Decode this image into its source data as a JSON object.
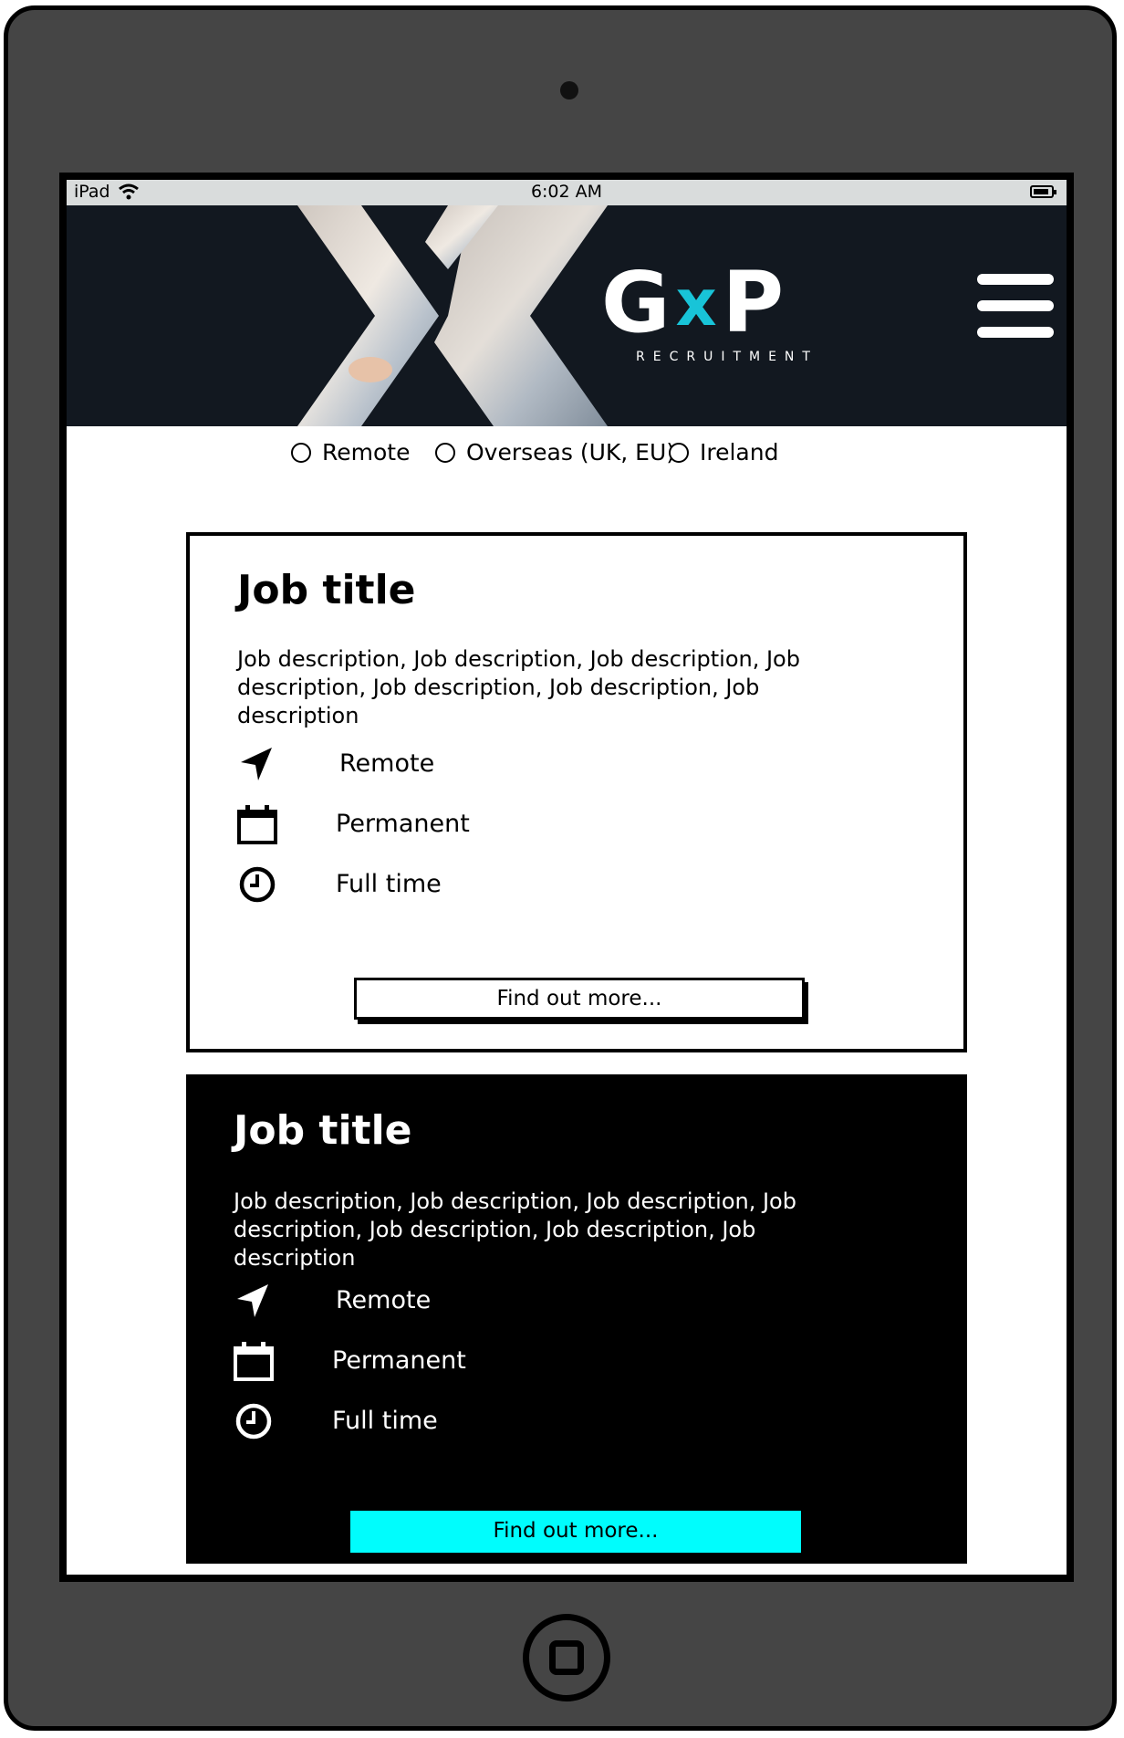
{
  "status_bar": {
    "device": "iPad",
    "time": "6:02 AM"
  },
  "header": {
    "logo_text_left": "G",
    "logo_text_mid": "x",
    "logo_text_right": "P",
    "logo_sub": "RECRUITMENT",
    "menu_icon": "hamburger-icon"
  },
  "filters": [
    {
      "label": "Remote",
      "selected": false
    },
    {
      "label": "Overseas (UK, EU)",
      "selected": false
    },
    {
      "label": "Ireland",
      "selected": false
    }
  ],
  "jobs": [
    {
      "title": "Job title",
      "description": "Job description, Job description, Job description, Job description, Job description, Job description, Job description",
      "location": "Remote",
      "contract": "Permanent",
      "hours": "Full time",
      "cta": "Find out more..."
    },
    {
      "title": "Job title",
      "description": "Job description, Job description, Job description, Job description, Job description, Job description, Job description",
      "location": "Remote",
      "contract": "Permanent",
      "hours": "Full time",
      "cta": "Find out more..."
    }
  ],
  "colors": {
    "header_bg": "#121820",
    "accent": "#18c4d8",
    "cta_highlight": "#00fdfd"
  }
}
